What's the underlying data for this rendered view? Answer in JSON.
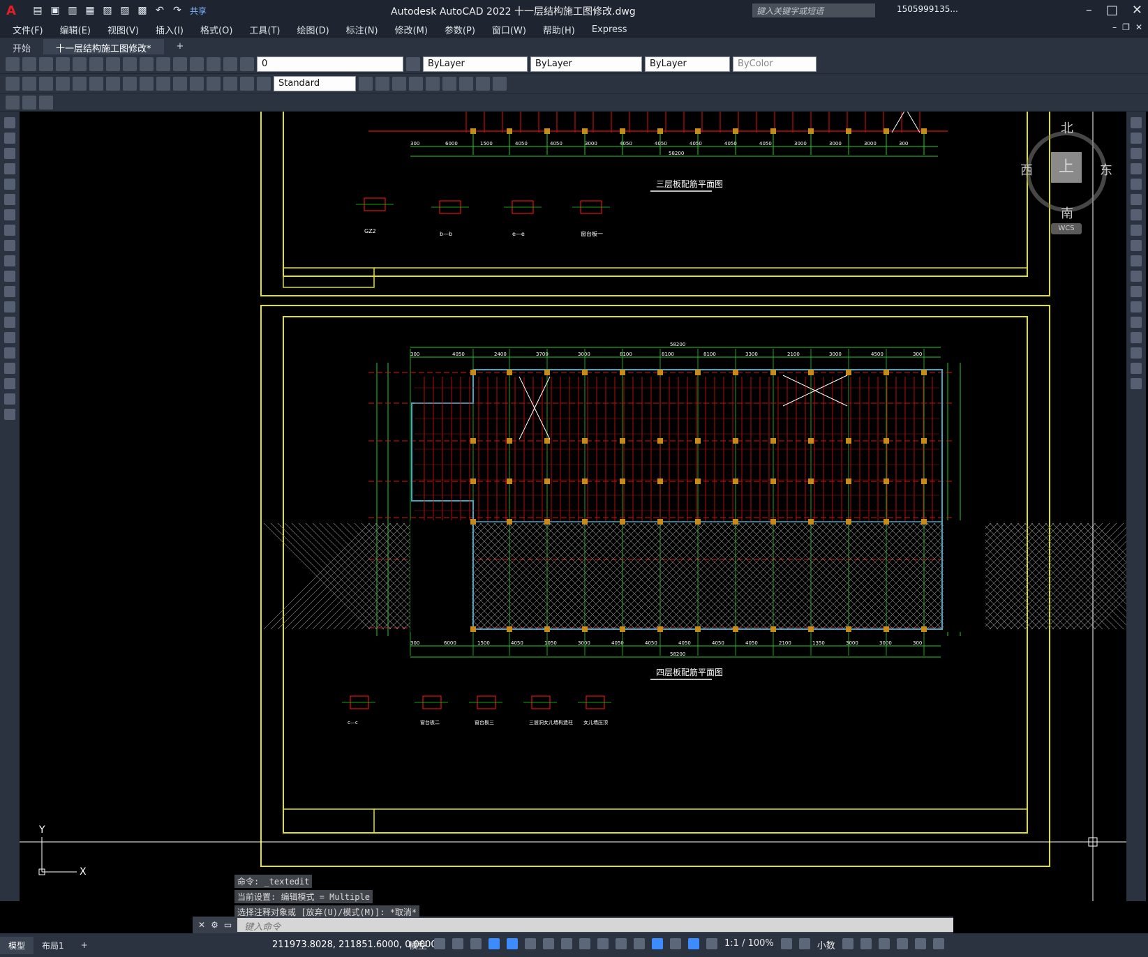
{
  "app": {
    "title": "Autodesk AutoCAD 2022    十一层结构施工图修改.dwg",
    "search_placeholder": "键入关键字或短语",
    "user": "1505999135...",
    "share_label": "共享"
  },
  "menu": [
    "文件(F)",
    "编辑(E)",
    "视图(V)",
    "插入(I)",
    "格式(O)",
    "工具(T)",
    "绘图(D)",
    "标注(N)",
    "修改(M)",
    "参数(P)",
    "窗口(W)",
    "帮助(H)",
    "Express"
  ],
  "tabs": [
    {
      "label": "开始",
      "active": false
    },
    {
      "label": "十一层结构施工图修改*",
      "active": true
    }
  ],
  "toolbar": {
    "layer_value": "0",
    "color_value": "ByLayer",
    "linetype_value": "ByLayer",
    "lineweight_value": "ByLayer",
    "plotstyle_value": "ByColor",
    "dimstyle_value": "Standard"
  },
  "viewcube": {
    "north": "北",
    "south": "南",
    "east": "东",
    "west": "西",
    "face": "上",
    "wcs": "WCS"
  },
  "drawing": {
    "title_top": "三层板配筋平面图",
    "title_bottom": "四层板配筋平面图",
    "section_labels": [
      "GZ2",
      "b—b",
      "e—e",
      "窗台板一",
      "c—c",
      "窗台板二",
      "窗台板三",
      "三层洞女儿墙构造柱",
      "女儿墙压顶"
    ],
    "dims_top": [
      "300",
      "6000",
      "1500",
      "4050",
      "4050",
      "3000",
      "4050",
      "4050",
      "4050",
      "4050",
      "4050",
      "3000",
      "3000",
      "3000",
      "300"
    ],
    "dims_bottom_top": [
      "300",
      "4050",
      "2400",
      "3700",
      "3000",
      "8100",
      "8100",
      "8100",
      "3300",
      "2100",
      "3000",
      "4500",
      "300"
    ],
    "total_top": "58200",
    "dims_bottom": [
      "300",
      "6000",
      "1500",
      "4050",
      "1050",
      "3000",
      "4050",
      "4050",
      "4050",
      "4050",
      "4050",
      "2100",
      "1350",
      "3000",
      "3000",
      "300"
    ],
    "total_bottom": "58200"
  },
  "command": {
    "history": [
      "命令: _textedit",
      "当前设置: 编辑模式 = Multiple",
      "选择注释对象或 [放弃(U)/模式(M)]: *取消*"
    ],
    "placeholder": "键入命令"
  },
  "status": {
    "layouts": [
      {
        "label": "模型",
        "active": true
      },
      {
        "label": "布局1",
        "active": false
      }
    ],
    "coords": "211973.8028, 211851.6000, 0.0000",
    "model_label": "模型",
    "scale": "1:1 / 100%",
    "units": "小数"
  }
}
